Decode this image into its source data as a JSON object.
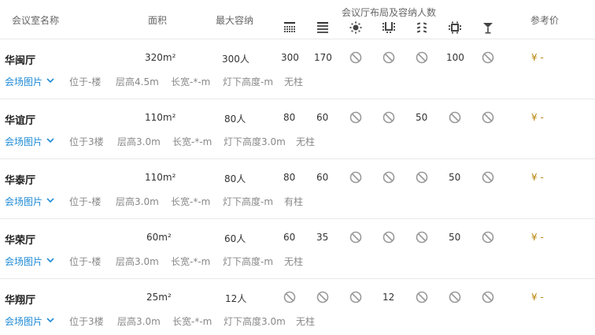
{
  "header": {
    "name": "会议室名称",
    "area": "面积",
    "capacity": "最大容纳",
    "layout": "会议厅布局及容纳人数",
    "price": "参考价"
  },
  "layout_icons": [
    "theater-icon",
    "classroom-icon",
    "banquet-icon",
    "u-shape-icon",
    "fishbone-icon",
    "boardroom-icon",
    "cocktail-icon"
  ],
  "rooms": [
    {
      "name": "华闽厅",
      "area": "320m²",
      "capacity": "300人",
      "layouts": [
        "300",
        "170",
        null,
        null,
        null,
        "100",
        null
      ],
      "price": "¥ -",
      "photo": "会场图片",
      "floor": "位于-楼",
      "height": "层高4.5m",
      "size": "长宽-*-m",
      "light": "灯下高度-m",
      "pillar": "无柱"
    },
    {
      "name": "华谊厅",
      "area": "110m²",
      "capacity": "80人",
      "layouts": [
        "80",
        "60",
        null,
        null,
        "50",
        null,
        null
      ],
      "price": "¥ -",
      "photo": "会场图片",
      "floor": "位于3楼",
      "height": "层高3.0m",
      "size": "长宽-*-m",
      "light": "灯下高度3.0m",
      "pillar": "无柱"
    },
    {
      "name": "华泰厅",
      "area": "110m²",
      "capacity": "80人",
      "layouts": [
        "80",
        "60",
        null,
        null,
        null,
        "50",
        null
      ],
      "price": "¥ -",
      "photo": "会场图片",
      "floor": "位于-楼",
      "height": "层高3.0m",
      "size": "长宽-*-m",
      "light": "灯下高度-m",
      "pillar": "有柱"
    },
    {
      "name": "华荣厅",
      "area": "60m²",
      "capacity": "60人",
      "layouts": [
        "60",
        "35",
        null,
        null,
        null,
        "50",
        null
      ],
      "price": "¥ -",
      "photo": "会场图片",
      "floor": "位于-楼",
      "height": "层高3.0m",
      "size": "长宽-*-m",
      "light": "灯下高度-m",
      "pillar": "无柱"
    },
    {
      "name": "华翔厅",
      "area": "25m²",
      "capacity": "12人",
      "layouts": [
        null,
        null,
        null,
        "12",
        null,
        null,
        null
      ],
      "price": "¥ -",
      "photo": "会场图片",
      "floor": "位于3楼",
      "height": "层高3.0m",
      "size": "长宽-*-m",
      "light": "灯下高度3.0m",
      "pillar": "无柱"
    }
  ],
  "colors": {
    "link": "#1e8ad6",
    "price": "#b8860b",
    "divider": "#e8e8e8",
    "disabled": "#999999"
  }
}
